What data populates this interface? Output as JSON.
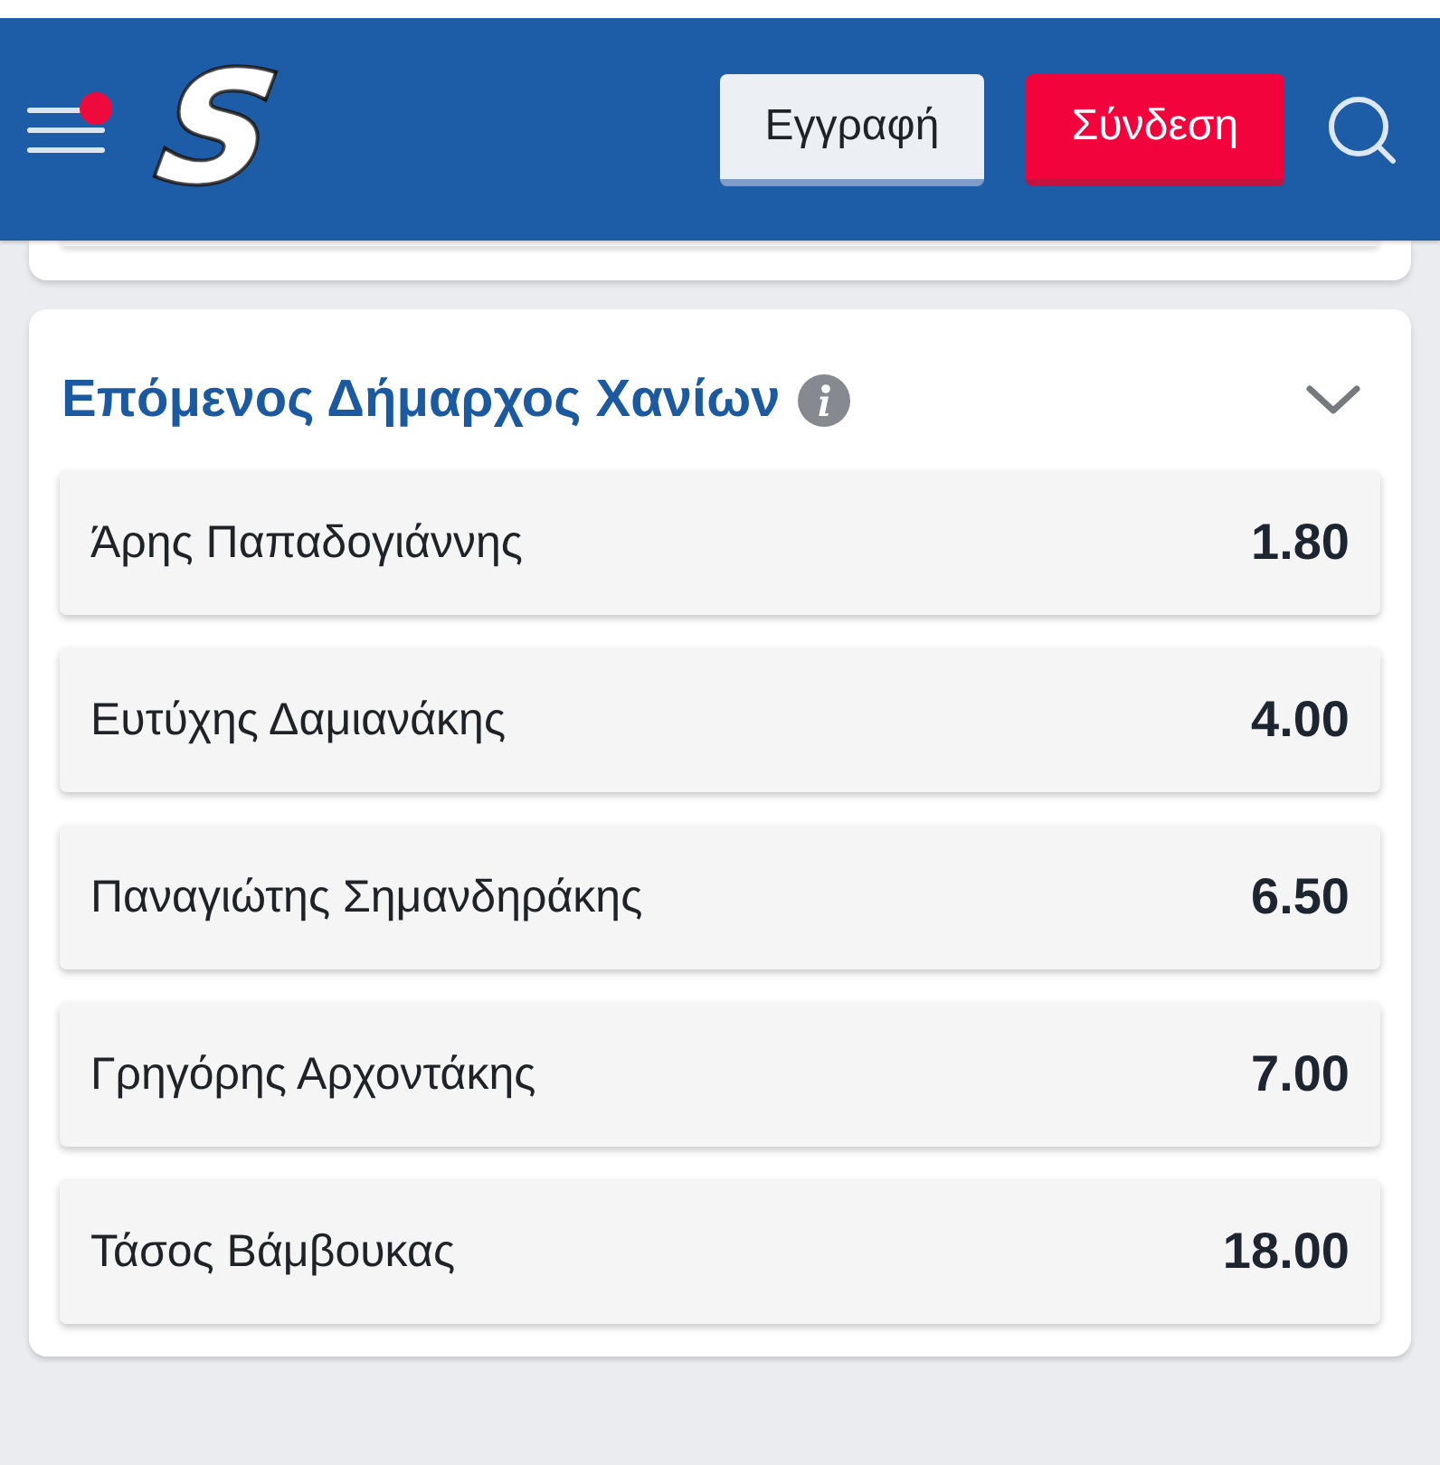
{
  "header": {
    "menu": {
      "notification": true
    },
    "logo": {
      "text": "S"
    },
    "buttons": [
      {
        "label": "Εγγραφή",
        "kind": "secondary"
      },
      {
        "label": "Σύνδεση",
        "kind": "primary"
      }
    ]
  },
  "market": {
    "title": "Επόμενος Δήμαρχος Χανίων",
    "expanded": true,
    "selections": [
      {
        "name": "Άρης Παπαδογιάννης",
        "odds": "1.80"
      },
      {
        "name": "Ευτύχης Δαμιανάκης",
        "odds": "4.00"
      },
      {
        "name": "Παναγιώτης Σημανδηράκης",
        "odds": "6.50"
      },
      {
        "name": "Γρηγόρης Αρχοντάκης",
        "odds": "7.00"
      },
      {
        "name": "Τάσος Βάμβουκας",
        "odds": "18.00"
      }
    ]
  }
}
